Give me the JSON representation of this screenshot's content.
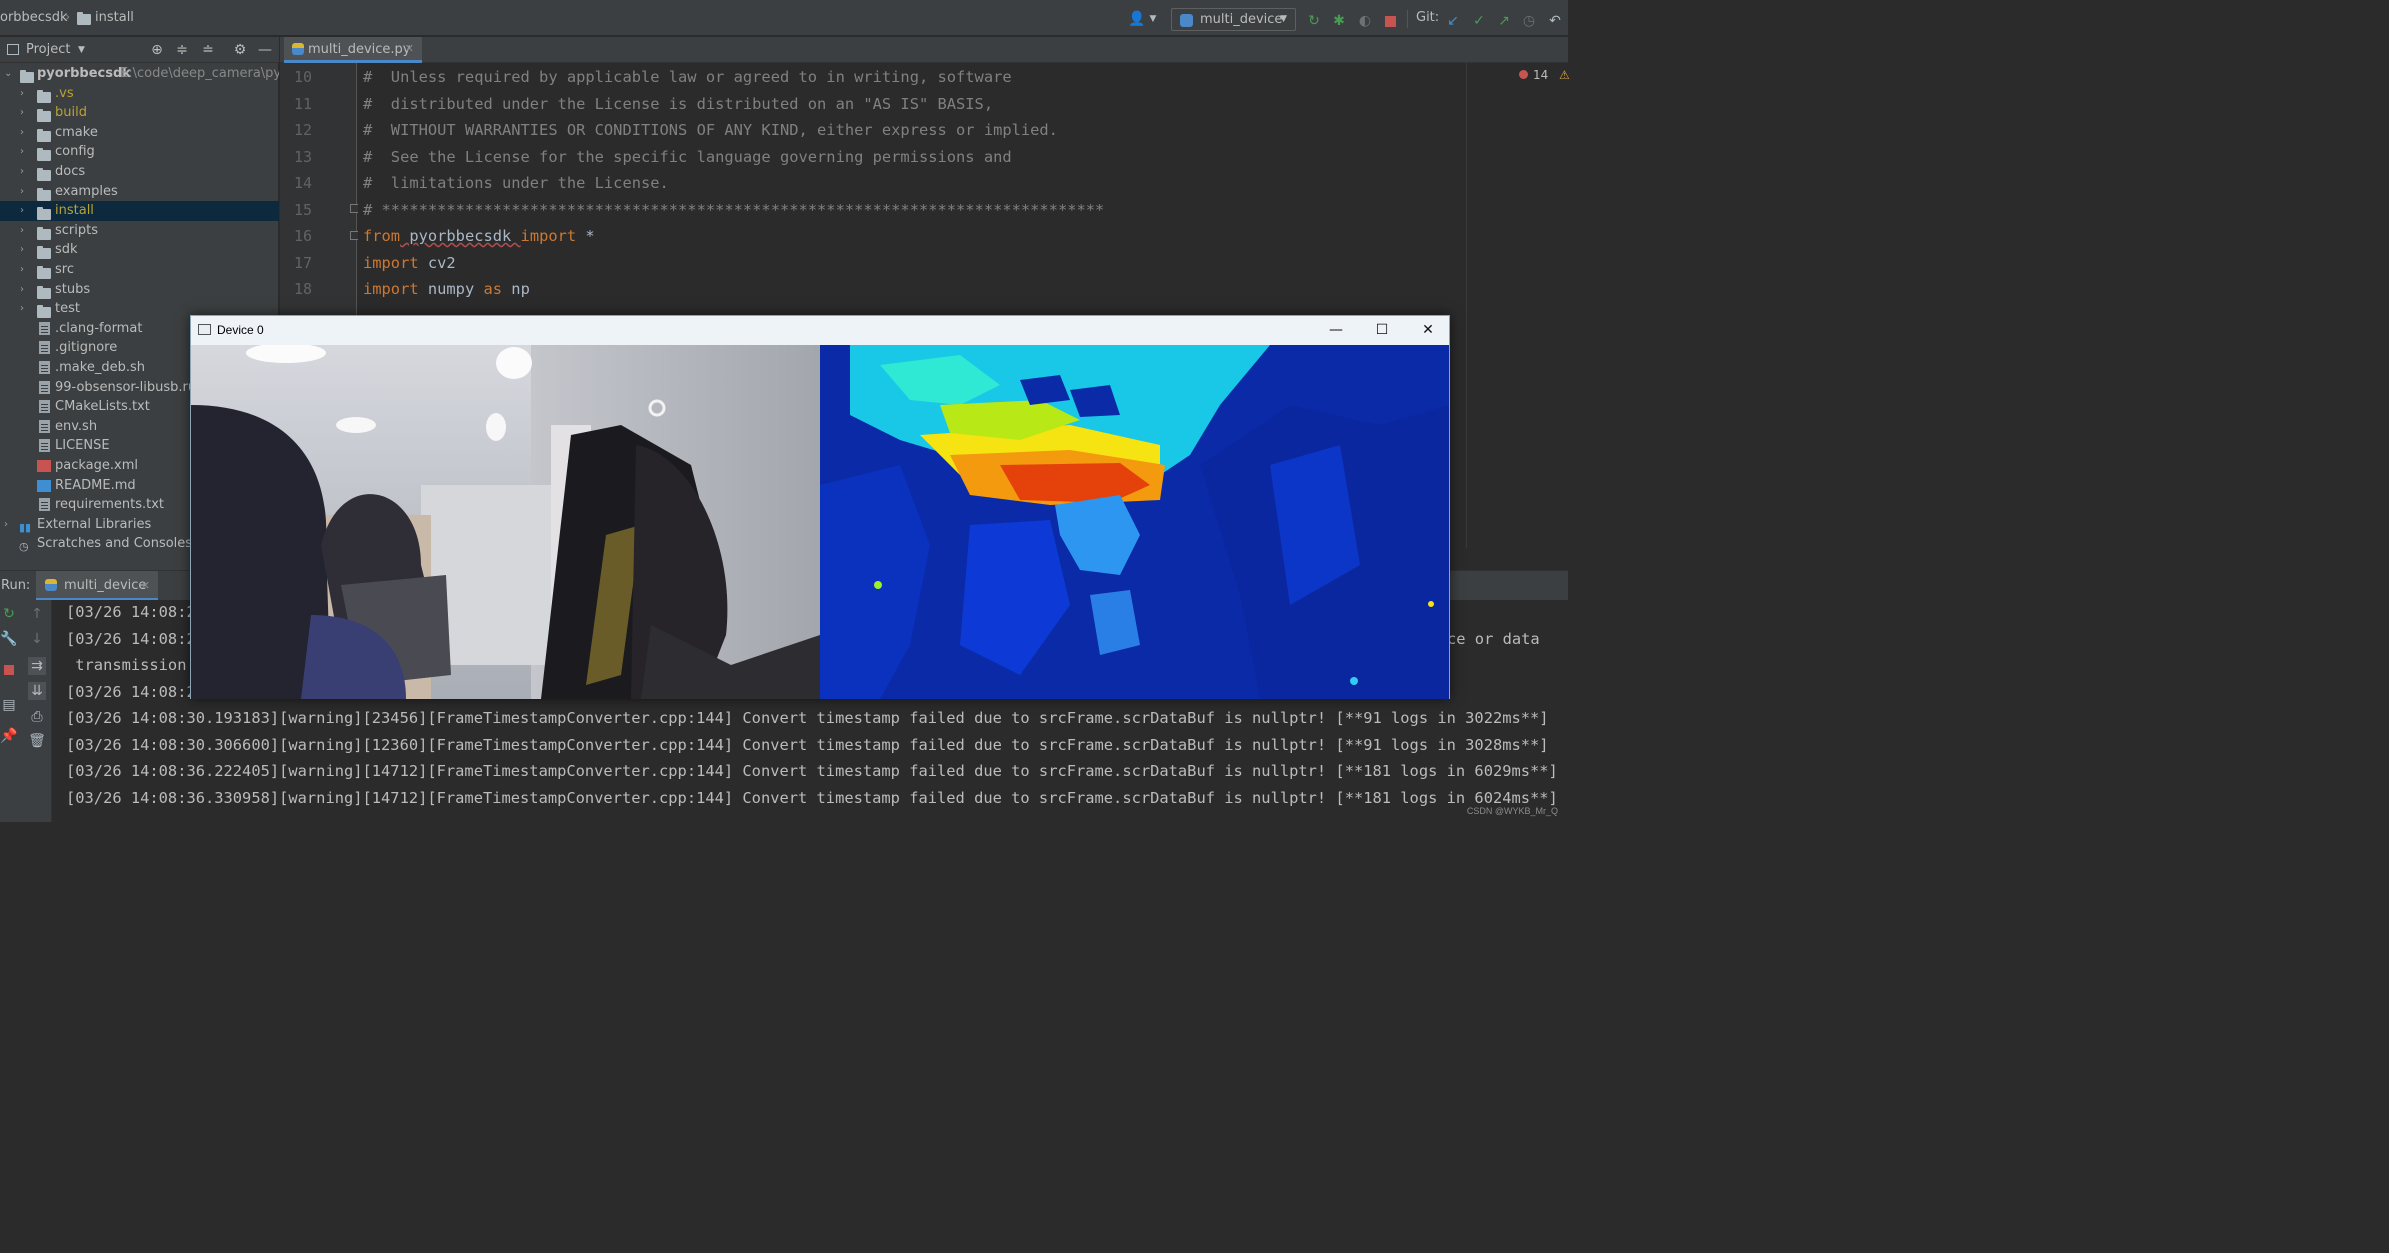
{
  "topbar": {
    "breadcrumb_root": "orbbecsdk",
    "breadcrumb_folder": "install",
    "run_config": "multi_device",
    "git_label": "Git:"
  },
  "project_panel": {
    "header": "Project",
    "root": {
      "name": "pyorbbecsdk",
      "path": "E:\\code\\deep_camera\\pyorb"
    },
    "folders": [
      ".vs",
      "build",
      "cmake",
      "config",
      "docs",
      "examples",
      "install",
      "scripts",
      "sdk",
      "src",
      "stubs",
      "test"
    ],
    "files": [
      ".clang-format",
      ".gitignore",
      ".make_deb.sh",
      "99-obsensor-libusb.rules",
      "CMakeLists.txt",
      "env.sh",
      "LICENSE",
      "package.xml",
      "README.md",
      "requirements.txt"
    ],
    "extra": [
      "External Libraries",
      "Scratches and Consoles"
    ]
  },
  "editor": {
    "tab": "multi_device.py",
    "error_count": "14",
    "lines": [
      {
        "n": "10",
        "text": "#  Unless required by applicable law or agreed to in writing, software"
      },
      {
        "n": "11",
        "text": "#  distributed under the License is distributed on an \"AS IS\" BASIS,"
      },
      {
        "n": "12",
        "text": "#  WITHOUT WARRANTIES OR CONDITIONS OF ANY KIND, either express or implied."
      },
      {
        "n": "13",
        "text": "#  See the License for the specific language governing permissions and"
      },
      {
        "n": "14",
        "text": "#  limitations under the License."
      },
      {
        "n": "15",
        "text": "# ******************************************************************************"
      },
      {
        "n": "16",
        "kw1": "from",
        "id1": " pyorbbecsdk ",
        "kw2": "import",
        "id2": " *"
      },
      {
        "n": "17",
        "kw1": "import",
        "id1": " cv2"
      },
      {
        "n": "18",
        "kw1": "import",
        "id1": " numpy ",
        "kw2": "as",
        "id2": " np"
      }
    ]
  },
  "run_panel": {
    "label": "Run:",
    "tab": "multi_device",
    "partial_lines": [
      "[03/26 14:08:2",
      "[03/26 14:08:2",
      " transmission",
      "[03/26 14:08:2"
    ],
    "right_fragment": "ce or data",
    "log_lines": [
      "[03/26 14:08:30.193183][warning][23456][FrameTimestampConverter.cpp:144] Convert timestamp failed due to srcFrame.scrDataBuf is nullptr! [**91 logs in 3022ms**]",
      "[03/26 14:08:30.306600][warning][12360][FrameTimestampConverter.cpp:144] Convert timestamp failed due to srcFrame.scrDataBuf is nullptr! [**91 logs in 3028ms**]",
      "[03/26 14:08:36.222405][warning][14712][FrameTimestampConverter.cpp:144] Convert timestamp failed due to srcFrame.scrDataBuf is nullptr! [**181 logs in 6029ms**]",
      "[03/26 14:08:36.330958][warning][14712][FrameTimestampConverter.cpp:144] Convert timestamp failed due to srcFrame.scrDataBuf is nullptr! [**181 logs in 6024ms**]"
    ]
  },
  "device_window": {
    "title": "Device 0",
    "minimize": "—",
    "maximize": "☐",
    "close": "✕"
  },
  "watermark": "CSDN @WYKB_Mr_Q",
  "colors": {
    "accent": "#4a88c7",
    "keyword": "#cc7832",
    "comment": "#808080",
    "selected_row": "#0d293e"
  }
}
